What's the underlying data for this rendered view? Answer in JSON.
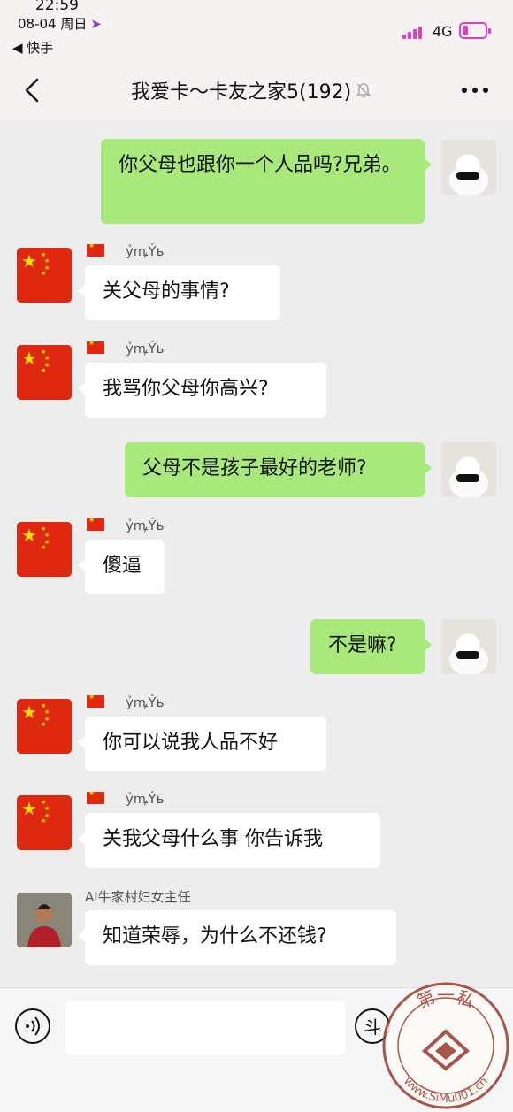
{
  "status_bar": {
    "time": "22:59",
    "date": "08-04 周日",
    "back_app": "◀ 快手",
    "network": "4G",
    "signal_bars": 4,
    "battery_level": 0.25,
    "accent_color": "#e040c0"
  },
  "header": {
    "title": "我爱卡～卡友之家5(192)",
    "muted": true
  },
  "messages": [
    {
      "side": "right",
      "sender": "",
      "text": "你父母也跟你一个人品吗?兄弟。"
    },
    {
      "side": "left",
      "sender": "ỷꝳÝь",
      "text": "关父母的事情?"
    },
    {
      "side": "left",
      "sender": "ỷꝳÝь",
      "text": "我骂你父母你高兴?"
    },
    {
      "side": "right",
      "sender": "",
      "text": "父母不是孩子最好的老师?"
    },
    {
      "side": "left",
      "sender": "ỷꝳÝь",
      "text": "傻逼"
    },
    {
      "side": "right",
      "sender": "",
      "text": "不是嘛?"
    },
    {
      "side": "left",
      "sender": "ỷꝳÝь",
      "text": "你可以说我人品不好"
    },
    {
      "side": "left",
      "sender": "ỷꝳÝь",
      "text": "关我父母什么事 你告诉我"
    },
    {
      "side": "left",
      "sender": "AI牛家村妇女主任",
      "text": "知道荣辱，为什么不还钱?"
    }
  ],
  "input_bar": {
    "placeholder": "",
    "emoji_label": "斗"
  },
  "watermark": {
    "top_text": "第一私",
    "url": "www.SiMu001.cn"
  },
  "colors": {
    "bubble_self": "#a9e97c",
    "bubble_other": "#ffffff",
    "chat_background": "#ededed",
    "flag_red": "#de2910",
    "flag_star": "#ffde00"
  }
}
